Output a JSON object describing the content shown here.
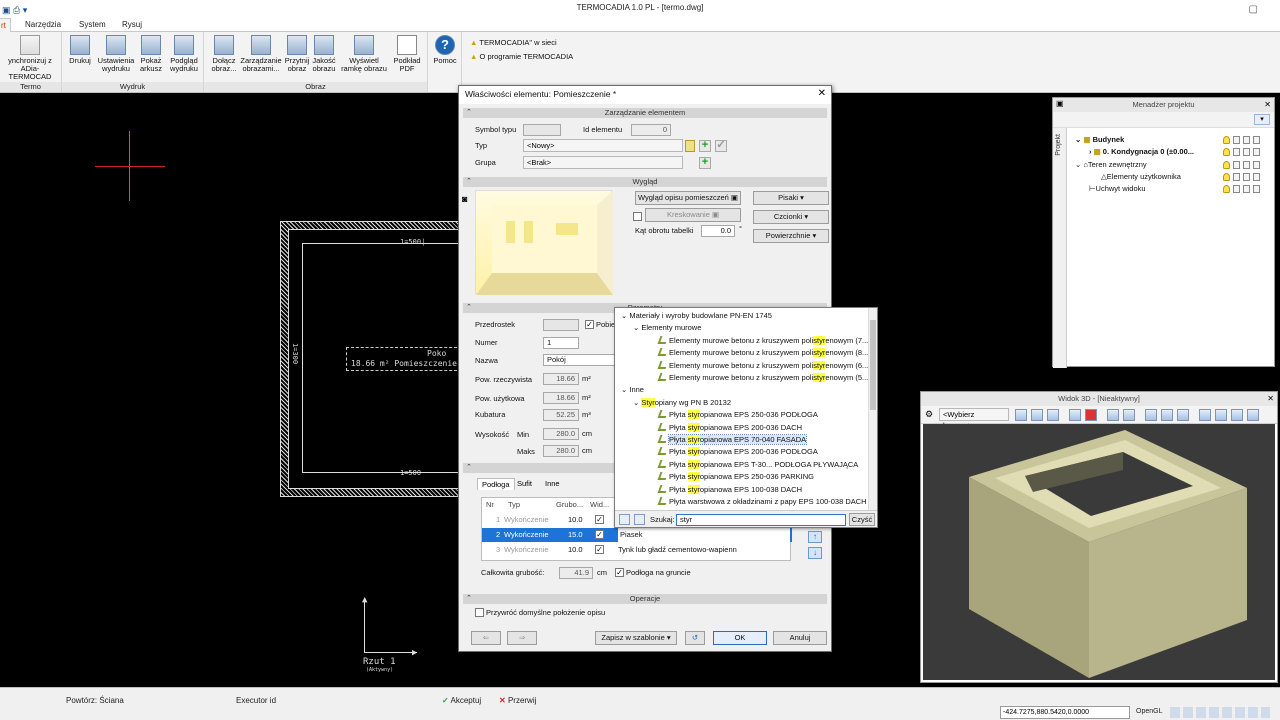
{
  "app": {
    "title": "TERMOCADIA 1.0 PL - [termo.dwg]"
  },
  "menu_tabs": [
    "rt",
    "Narzędzia",
    "System",
    "Rysuj"
  ],
  "ribbon": {
    "groups": [
      "Termo",
      "Wydruk",
      "Obraz"
    ],
    "sync_label": "ynchronizuj z\nADia-TERMOCAD",
    "buttons": [
      {
        "label": "Drukuj"
      },
      {
        "label": "Ustawienia\nwydruku"
      },
      {
        "label": "Pokaż\narkusz"
      },
      {
        "label": "Podgląd\nwydruku"
      },
      {
        "label": "Dołącz\nobraz..."
      },
      {
        "label": "Zarządzanie\nobrazami..."
      },
      {
        "label": "Przytnij\nobraz"
      },
      {
        "label": "Jakość\nobrazu"
      },
      {
        "label": "Wyświetl\nramkę obrazu"
      },
      {
        "label": "Podkład\nPDF"
      },
      {
        "label": "Pomoc"
      }
    ],
    "links": [
      "TERMOCADIA\" w sieci",
      "O programie TERMOCADIA"
    ]
  },
  "cad": {
    "label_top": "1=500|",
    "label_bottom": "1=500",
    "label_left": "1=300",
    "room_label_1": "Poko",
    "room_label_2": "18.66 m²  Pomieszczenie",
    "view_label": "Rzut 1",
    "view_sub": "(Aktywny)"
  },
  "dialog": {
    "title": "Właściwości elementu: Pomieszczenie *",
    "sections": {
      "manage": "Zarządzanie elementem",
      "look": "Wygląd",
      "params": "Parametry",
      "ops": "Operacje"
    },
    "symbol_label": "Symbol typu",
    "id_label": "Id elementu",
    "id_value": "0",
    "type_label": "Typ",
    "type_value": "<Nowy>",
    "group_label": "Grupa",
    "group_value": "<Brak>",
    "look_btn": "Wygląd opisu pomieszczeń",
    "hatch_btn": "Kreskowanie",
    "angle_label": "Kąt obrotu tabelki",
    "angle_value": "0.0",
    "angle_unit": "°",
    "pens_btn": "Pisaki",
    "fonts_btn": "Czcionki",
    "surfaces_btn": "Powierzchnie",
    "prefix_label": "Przedrostek",
    "prefix_chk": "Pobie",
    "number_label": "Numer",
    "number_value": "1",
    "name_label": "Nazwa",
    "name_value": "Pokój",
    "area_label": "Pow. rzeczywista",
    "area_value": "18.66",
    "usable_label": "Pow. użytkowa",
    "usable_value": "18.66",
    "m2": "m²",
    "m3": "m³",
    "cm": "cm",
    "volume_label": "Kubatura",
    "volume_value": "52.25",
    "height_label": "Wysokość",
    "min_label": "Min",
    "min_value": "280.0",
    "max_label": "Maks",
    "max_value": "280.0",
    "subtabs": [
      "Podłoga",
      "Sufit",
      "Inne"
    ],
    "table_headers": [
      "Nr",
      "Typ",
      "Grubo...",
      "Wid..."
    ],
    "rows": [
      {
        "nr": "1",
        "typ": "Wykończenie",
        "grub": "10.0",
        "mat": ""
      },
      {
        "nr": "2",
        "typ": "Wykończenie",
        "grub": "15.0",
        "mat": "Piasek"
      },
      {
        "nr": "3",
        "typ": "Wykończenie",
        "grub": "10.0",
        "mat": "Tynk lub gładź cementowo-wapienn"
      }
    ],
    "total_label": "Całkowita grubość:",
    "total_value": "41.9",
    "ground_label": "Podłoga na gruncie",
    "restore_label": "Przywróć domyślne położenie opisu",
    "save_btn": "Zapisz w szablonie",
    "ok_btn": "OK",
    "cancel_btn": "Anuluj"
  },
  "popup": {
    "items": [
      {
        "lvl": 0,
        "text": "Materiały i wyroby budowlane PN-EN 1745",
        "hl": ""
      },
      {
        "lvl": 1,
        "text": "Elementy murowe",
        "hl": ""
      },
      {
        "lvl": 2,
        "pre": "Elementy murowe betonu z kruszywem poli",
        "hl": "styr",
        "post": "enowym (7..."
      },
      {
        "lvl": 2,
        "pre": "Elementy murowe betonu z kruszywem poli",
        "hl": "styr",
        "post": "enowym (8..."
      },
      {
        "lvl": 2,
        "pre": "Elementy murowe betonu z kruszywem poli",
        "hl": "styr",
        "post": "enowym (6..."
      },
      {
        "lvl": 2,
        "pre": "Elementy murowe betonu z kruszywem poli",
        "hl": "styr",
        "post": "enowym (5..."
      },
      {
        "lvl": 0,
        "text": "Inne",
        "hl": ""
      },
      {
        "lvl": 1,
        "pre": "",
        "hl": "Styr",
        "post": "opiany wg PN B 20132"
      },
      {
        "lvl": 2,
        "pre": "Płyta ",
        "hl": "styr",
        "post": "opianowa EPS 250-036 PODŁOGA"
      },
      {
        "lvl": 2,
        "pre": "Płyta ",
        "hl": "styr",
        "post": "opianowa EPS 200-036 DACH"
      },
      {
        "lvl": 2,
        "pre": "Płyta ",
        "hl": "styr",
        "post": "opianowa EPS 70-040 FASADA",
        "sel": true
      },
      {
        "lvl": 2,
        "pre": "Płyta ",
        "hl": "styr",
        "post": "opianowa EPS 200-036 PODŁOGA"
      },
      {
        "lvl": 2,
        "pre": "Płyta ",
        "hl": "styr",
        "post": "opianowa EPS T-30... PODŁOGA PŁYWAJĄCA"
      },
      {
        "lvl": 2,
        "pre": "Płyta ",
        "hl": "styr",
        "post": "opianowa EPS 250-036 PARKING"
      },
      {
        "lvl": 2,
        "pre": "Płyta ",
        "hl": "styr",
        "post": "opianowa EPS 100-038 DACH"
      },
      {
        "lvl": 2,
        "pre": "Płyta warstwowa z okładzinami z papy EPS 100-038 DACH",
        "hl": "",
        "post": ""
      }
    ],
    "search_label": "Szukaj:",
    "search_value": "styr",
    "clear_btn": "Czyść"
  },
  "project": {
    "title": "Menadżer projektu",
    "side_tab": "Projekt",
    "tree": [
      "Budynek",
      "0. Kondygnacja 0 (±0.00...",
      "Teren zewnętrzny",
      "Elementy użytkownika",
      "Uchwyt widoku"
    ]
  },
  "view3d": {
    "title": "Widok 3D - [Nieaktywny]",
    "camera": "<Wybierz kamerę>"
  },
  "statusbar": {
    "repeat": "Powtórz: Ściana",
    "executor": "Executor id",
    "accept": "Akceptuj",
    "abort": "Przerwij",
    "coords": "-424.7275,880.5420,0.0000",
    "opengl": "OpenGL"
  },
  "colors": {
    "accent": "#1e73d7",
    "highlight": "#ffff44",
    "ribbon": "#f3f3f3"
  }
}
